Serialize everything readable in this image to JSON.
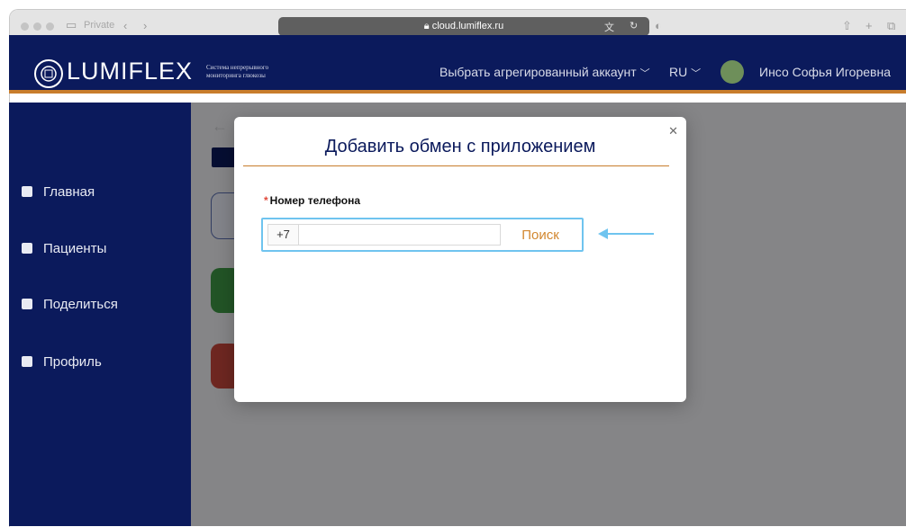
{
  "browser": {
    "private_label": "Private",
    "url": "cloud.lumiflex.ru"
  },
  "app": {
    "logo_text": "LUMIFLEX",
    "tagline": "Система непрерывного\nмониторинга глюкозы",
    "account_selector": "Выбрать агрегированный аккаунт",
    "language": "RU",
    "user_name": "Инсо Софья Игоревна"
  },
  "sidebar": {
    "items": [
      {
        "label": "Главная",
        "icon": "home-icon"
      },
      {
        "label": "Пациенты",
        "icon": "patients-icon"
      },
      {
        "label": "Поделиться",
        "icon": "share-icon"
      },
      {
        "label": "Профиль",
        "icon": "profile-icon"
      }
    ]
  },
  "modal": {
    "title": "Добавить обмен с приложением",
    "field_required_mark": "*",
    "field_label": "Номер телефона",
    "phone_prefix": "+7",
    "phone_value": "",
    "phone_placeholder": "",
    "search_button": "Поиск"
  },
  "colors": {
    "brand_navy": "#0b1a5c",
    "accent_orange": "#c87d2c",
    "highlight_blue": "#6fc4ef"
  }
}
